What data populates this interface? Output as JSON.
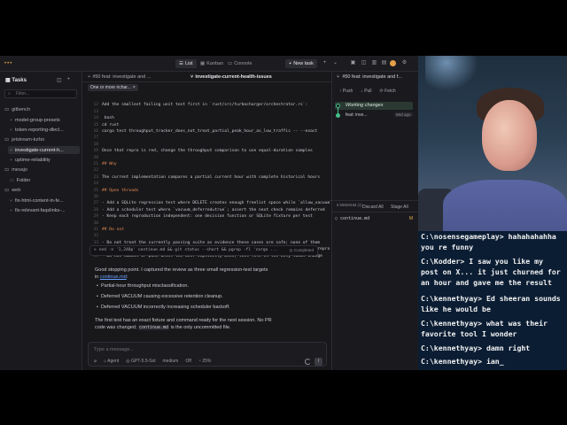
{
  "app": {
    "toolbar": {
      "list_label": "List",
      "kanban_label": "Kanban",
      "console_label": "Console",
      "new_task_label": "New task"
    },
    "sidebar": {
      "title": "Tasks",
      "filter_placeholder": "Filter...",
      "groups": [
        {
          "name": "gitbench",
          "items": [
            "model-group-presets",
            "token-reporting-dlecl..."
          ]
        },
        {
          "name": "jetstream-turbo",
          "items": [
            "investigate-current-h...",
            "uptime-reliability"
          ]
        },
        {
          "name": "mesajo",
          "items": [
            "Folder"
          ]
        },
        {
          "name": "web",
          "items": [
            "fix-html-content-in-fe...",
            "fix-relevant-faqslinks-..."
          ]
        }
      ]
    },
    "main": {
      "crumb_1": "#50 feat: investigate and ...",
      "crumb_2": "investigate-current-health-issues",
      "subtab": "One or more richar...",
      "code_lines": [
        {
          "n": "",
          "t": "",
          "cls": ""
        },
        {
          "n": "12",
          "t": "Add the smallest failing unit test first in `rust/src/turbocharger/orchestrator.rs`:",
          "cls": ""
        },
        {
          "n": "13",
          "t": "",
          "cls": ""
        },
        {
          "n": "14",
          "t": "  bash",
          "cls": ""
        },
        {
          "n": "15",
          "t": "cd rust",
          "cls": ""
        },
        {
          "n": "16",
          "t": "cargo test throughput_tracker_does_not_treat_partial_peak_hour_as_low_traffic -- --exact",
          "cls": ""
        },
        {
          "n": "17",
          "t": "",
          "cls": ""
        },
        {
          "n": "18",
          "t": "",
          "cls": ""
        },
        {
          "n": "19",
          "t": "Once that repro is red, change the throughput comparison to use equal-duration samples",
          "cls": ""
        },
        {
          "n": "20",
          "t": "",
          "cls": ""
        },
        {
          "n": "21",
          "t": "## Why",
          "cls": "h"
        },
        {
          "n": "22",
          "t": "",
          "cls": ""
        },
        {
          "n": "23",
          "t": "The current implementation compares a partial current hour with complete historical hours",
          "cls": ""
        },
        {
          "n": "24",
          "t": "",
          "cls": ""
        },
        {
          "n": "25",
          "t": "## Open threads",
          "cls": "h"
        },
        {
          "n": "26",
          "t": "",
          "cls": ""
        },
        {
          "n": "27",
          "t": "- Add a SQLite regression test where DELETE creates enough freelist space while `allow_vacuum` is false",
          "cls": "li"
        },
        {
          "n": "28",
          "t": "- Add a scheduler test where `vacuum_deferred=true`; assert the next check remains deferred",
          "cls": "li"
        },
        {
          "n": "29",
          "t": "- Keep each reproduction independent: one decision function or SQLite fixture per test",
          "cls": "li"
        },
        {
          "n": "30",
          "t": "",
          "cls": ""
        },
        {
          "n": "31",
          "t": "## Do not",
          "cls": "h"
        },
        {
          "n": "32",
          "t": "",
          "cls": ""
        },
        {
          "n": "33",
          "t": "- Do not treat the currently passing suite as evidence these cases are safe; none of them",
          "cls": "li"
        },
        {
          "n": "34",
          "t": "- Do not modify unrelated cache TTL, batching, or deployment changes while building the repro",
          "cls": "li"
        },
        {
          "n": "35",
          "t": "- Do not commit or push until the user explicitly asks; this file is the only local change",
          "cls": "li"
        }
      ],
      "command": "> sed -n '1,240p' continue.md && git status --short && pgrep -fl 'cargo ...",
      "command_status": "Completed",
      "message_intro_1": "Good stopping point. I captured the review as three small regression-test targets",
      "message_intro_2_prefix": "in",
      "message_link": "continue.md",
      "message_intro_2_suffix": ":",
      "bullets": [
        "Partial-hour throughput misclassification.",
        "Deferred VACUUM causing excessive retention cleanup.",
        "Deferred VACUUM incorrectly increasing scheduler backoff."
      ],
      "closing_1": "The first test has an exact fixture and command ready for the next session. No PR",
      "closing_2_prefix": "code was changed;",
      "closing_code": "continue.md",
      "closing_2_suffix": "is the only uncommitted file.",
      "composer_placeholder": "Type a message...",
      "composer_agent": "Agent",
      "composer_model": "GPT-5.5-Sol",
      "composer_effort": "medium",
      "composer_off": "Off",
      "composer_context": "25%"
    },
    "right_panel": {
      "title": "#50 feat: investigate and f...",
      "push_label": "Push",
      "pull_label": "Pull",
      "fetch_label": "Fetch",
      "working_changes": "Working changes",
      "commit_label": "feat: inve...",
      "commit_age": "59d ago",
      "changes_count": "0 MINIMUM (1)",
      "discard_all": "Discard All",
      "stage_all": "Stage All",
      "file_name": "continue.md",
      "file_status": "M"
    }
  },
  "chat": [
    "C:\\nosensegameplay> hahahahahha you re funny",
    "C:\\Kodder> I saw you like my post on X... it just churned for an hour and gave me the result",
    "C:\\kennethyay> Ed sheeran sounds like he would be",
    "C:\\kennethyay> what was their favorite tool I wonder",
    "C:\\kennethyay> damn right",
    "C:\\kennethyay> ian_"
  ]
}
